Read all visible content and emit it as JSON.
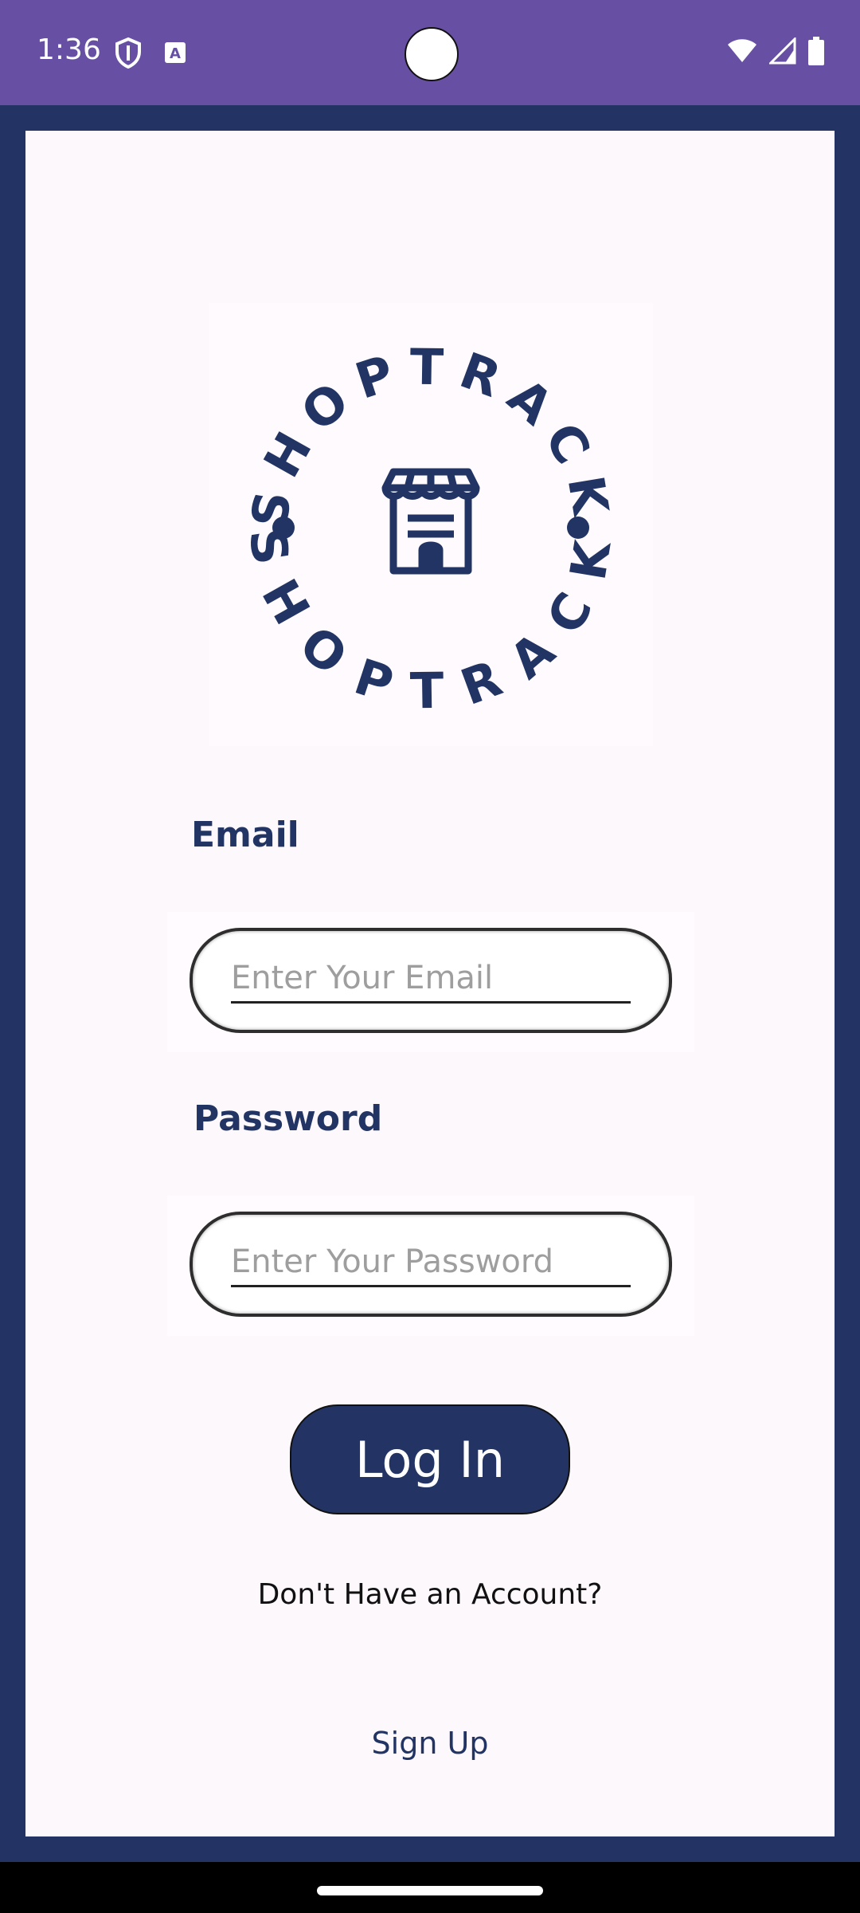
{
  "status_bar": {
    "time": "1:36",
    "icons": [
      "shield-icon",
      "a-keyboard-icon",
      "wifi-icon",
      "signal-icon",
      "battery-icon"
    ]
  },
  "logo": {
    "brand_text": "SHOPTRACK",
    "icon": "storefront-icon",
    "color": "#223463"
  },
  "form": {
    "email_label": "Email",
    "email_placeholder": "Enter Your Email",
    "password_label": "Password",
    "password_placeholder": "Enter Your Password",
    "login_label": "Log In",
    "no_account_text": "Don't Have an Account?",
    "signup_label": "Sign Up"
  },
  "colors": {
    "accent": "#233464",
    "status_bar": "#6750a4",
    "card_background": "#fdf8fc"
  }
}
